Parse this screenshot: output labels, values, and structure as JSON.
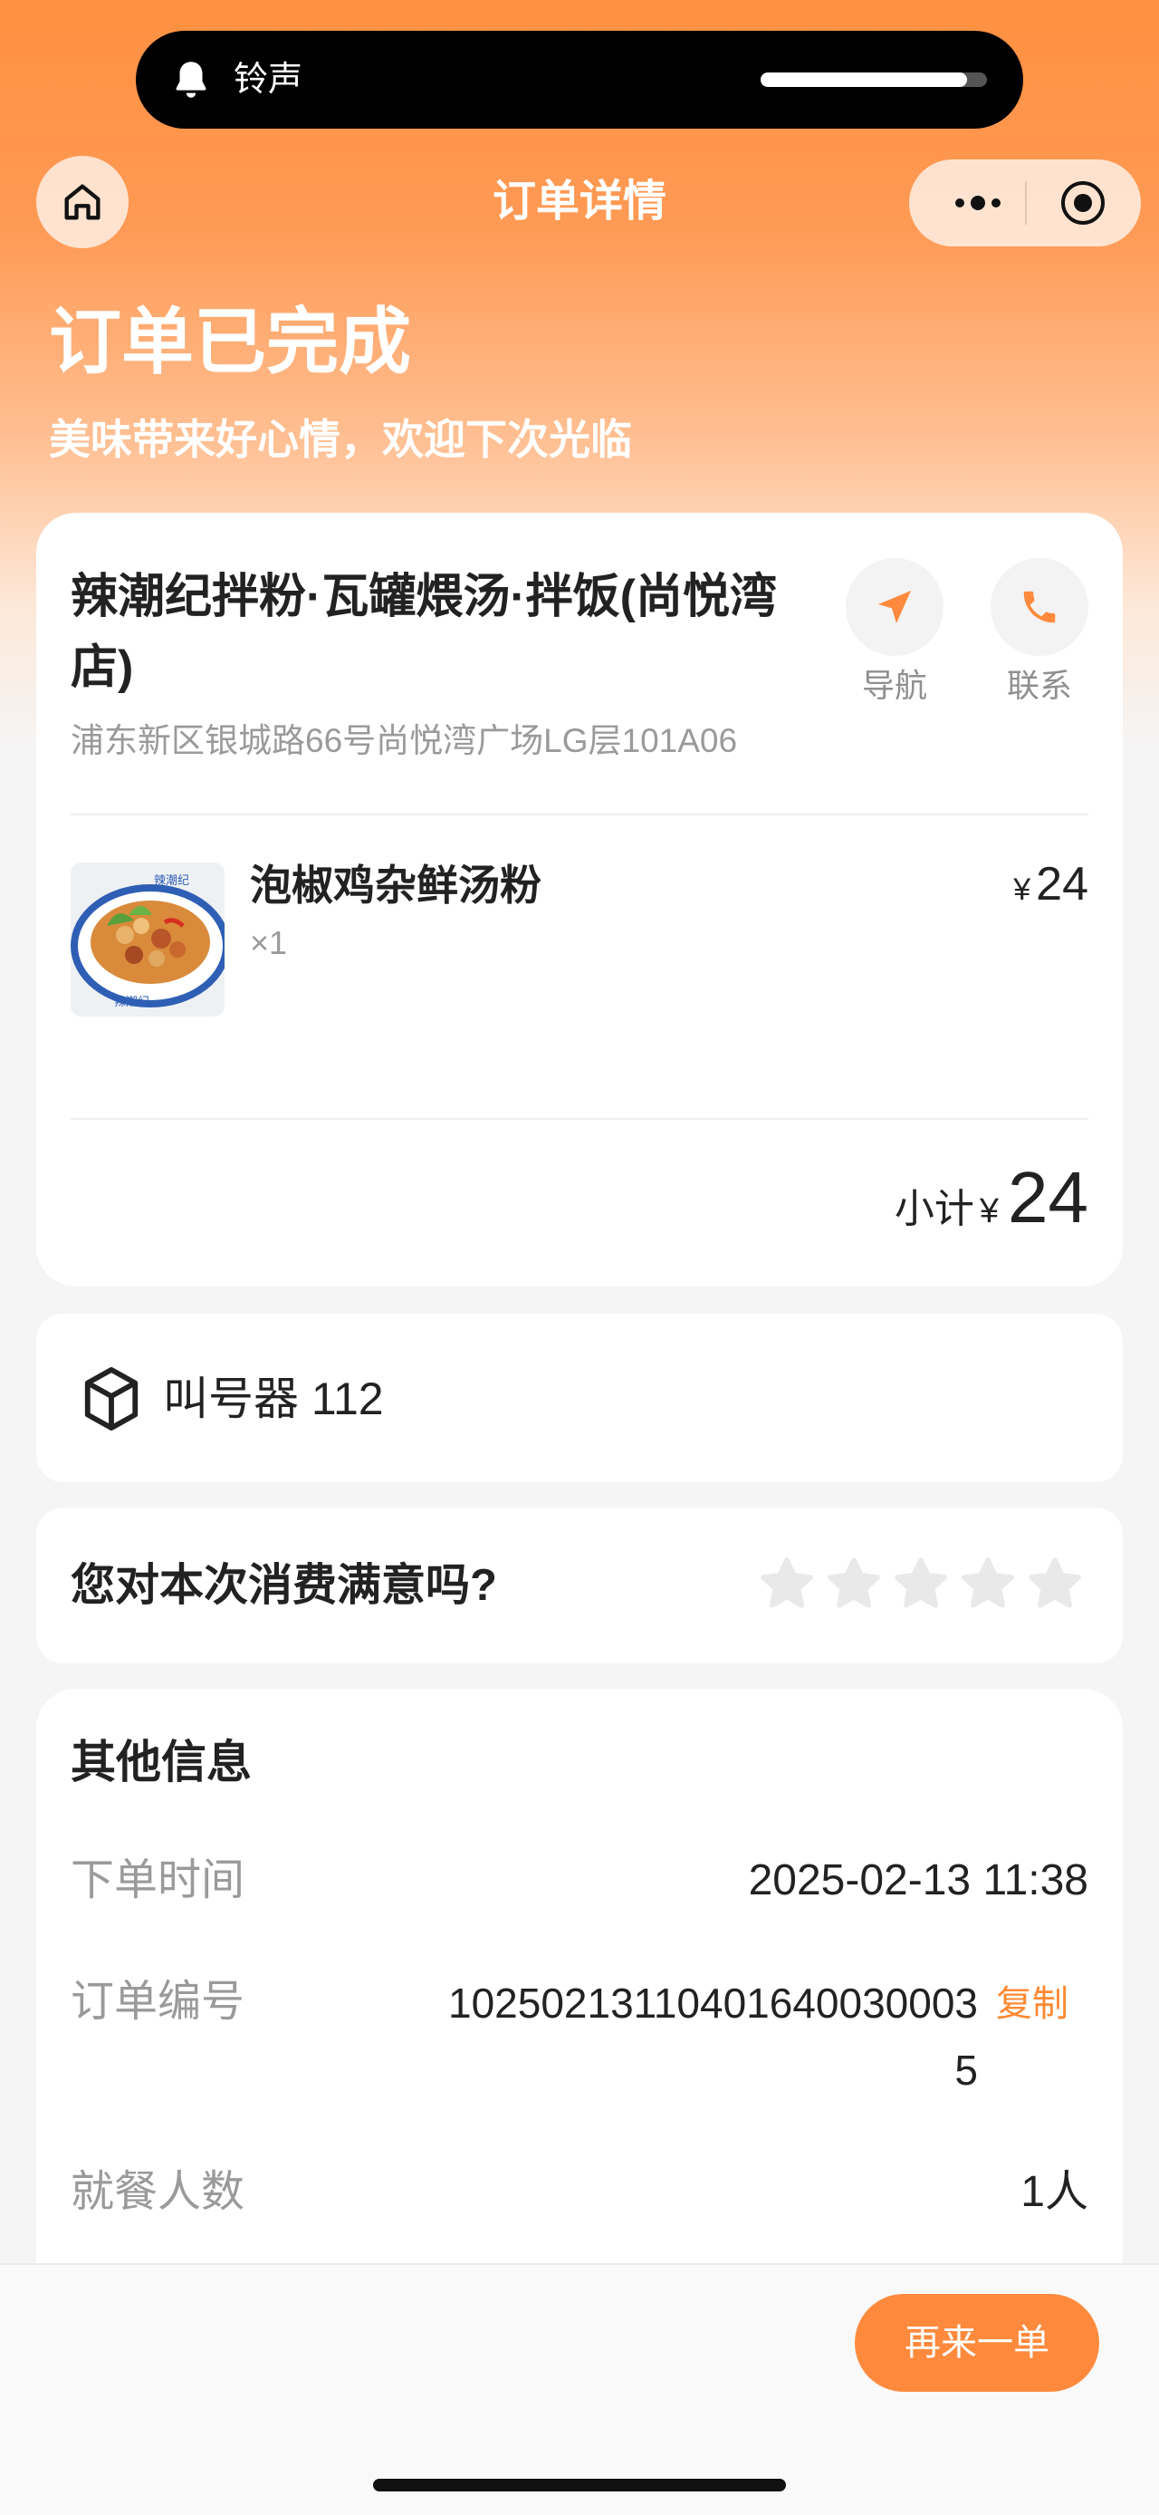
{
  "system": {
    "ringer_label": "铃声",
    "ringer_level": 0.91
  },
  "navbar": {
    "title": "订单详情"
  },
  "status": {
    "title": "订单已完成",
    "subtitle": "美味带来好心情，欢迎下次光临"
  },
  "store": {
    "name": "辣潮纪拌粉·瓦罐煨汤·拌饭(尚悦湾店)",
    "address": "浦东新区银城路66号尚悦湾广场LG层101A06",
    "nav_label": "导航",
    "contact_label": "联系"
  },
  "order_item": {
    "name": "泡椒鸡杂鲜汤粉",
    "qty": "×1",
    "currency": "¥",
    "price": "24",
    "bowl_text": "辣潮纪"
  },
  "subtotal": {
    "label": "小计",
    "currency": "¥",
    "amount": "24"
  },
  "caller": {
    "text": "叫号器 112"
  },
  "rating": {
    "question": "您对本次消费满意吗?",
    "max_stars": 5,
    "value": 0
  },
  "other_info": {
    "title": "其他信息",
    "order_time_label": "下单时间",
    "order_time": "2025-02-13 11:38",
    "order_no_label": "订单编号",
    "order_no_line1": "10250213110401640030003",
    "order_no_line2": "5",
    "copy_label": "复制",
    "diners_label": "就餐人数",
    "diners": "1人"
  },
  "bottom": {
    "reorder_label": "再来一单"
  },
  "colors": {
    "accent": "#ff8a3d",
    "star_empty": "#e9e9e9"
  }
}
